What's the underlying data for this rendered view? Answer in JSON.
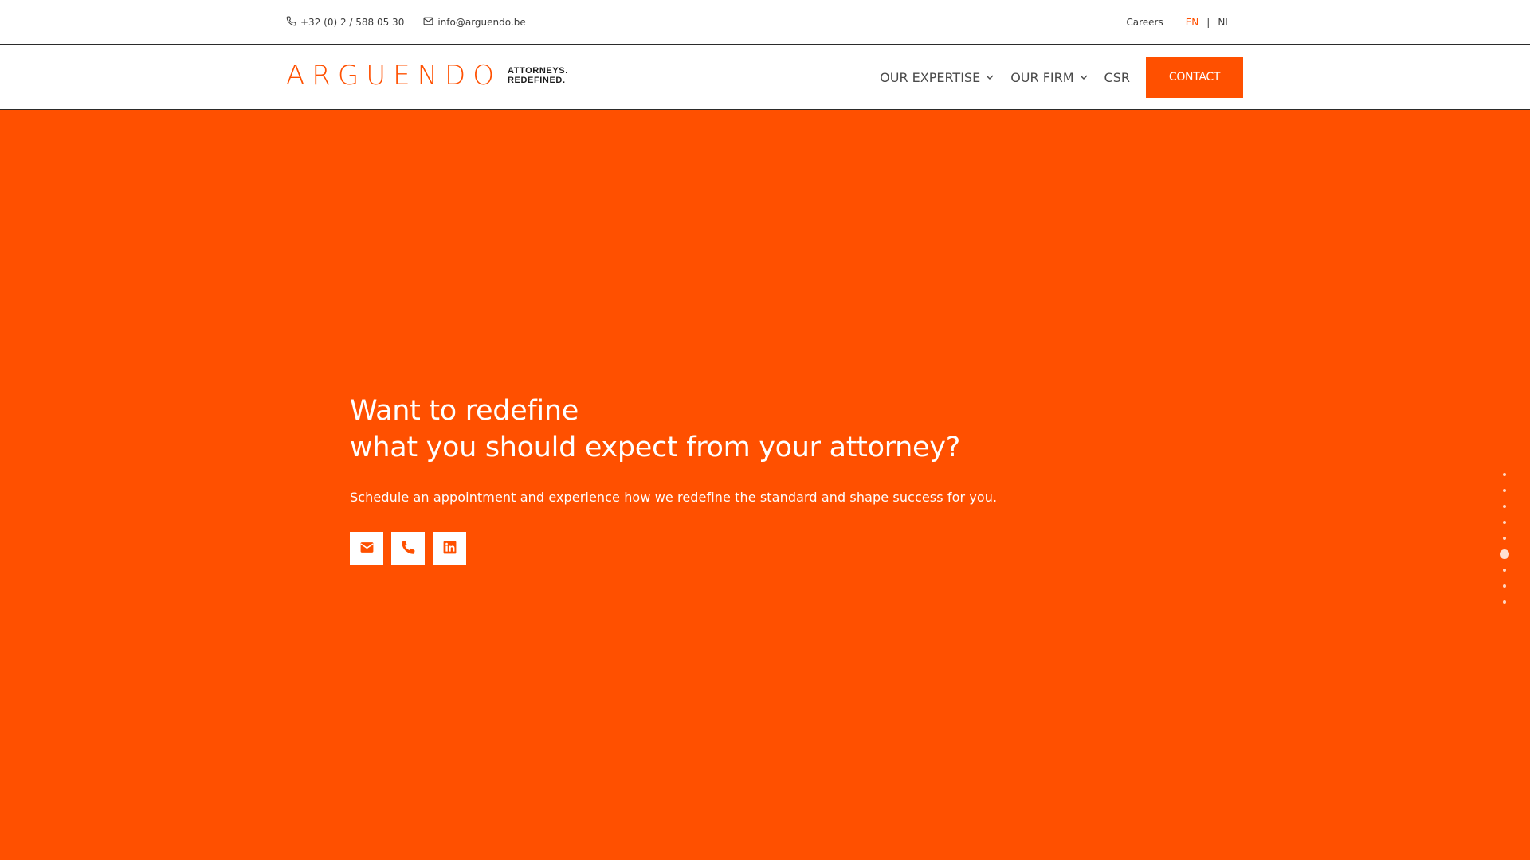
{
  "topbar": {
    "phone": "+32 (0) 2 / 588 05 30",
    "email": "info@arguendo.be",
    "careers": "Careers",
    "lang_active": "EN",
    "lang_separator": "|",
    "lang_other": "NL",
    "phone_icon": "phone-icon",
    "email_icon": "envelope-icon"
  },
  "header": {
    "logo_word": "ARGUENDO",
    "logo_tag_line1": "ATTORNEYS.",
    "logo_tag_line2": "REDEFINED.",
    "nav": {
      "expertise": "OUR EXPERTISE",
      "firm": "OUR FIRM",
      "csr": "CSR"
    },
    "contact_label": "CONTACT"
  },
  "hero": {
    "title_line1": "Want to redefine",
    "title_line2": "what you should expect from your attorney?",
    "subtitle": "Schedule an appointment and experience how we redefine the standard and shape success for you.",
    "icons": [
      "envelope-icon",
      "phone-icon",
      "linkedin-icon"
    ]
  },
  "side_nav": {
    "dot_count": 9,
    "active_index": 5
  },
  "colors": {
    "brand": "#ff5000",
    "text_dark": "#3c3c3c",
    "white": "#ffffff"
  }
}
